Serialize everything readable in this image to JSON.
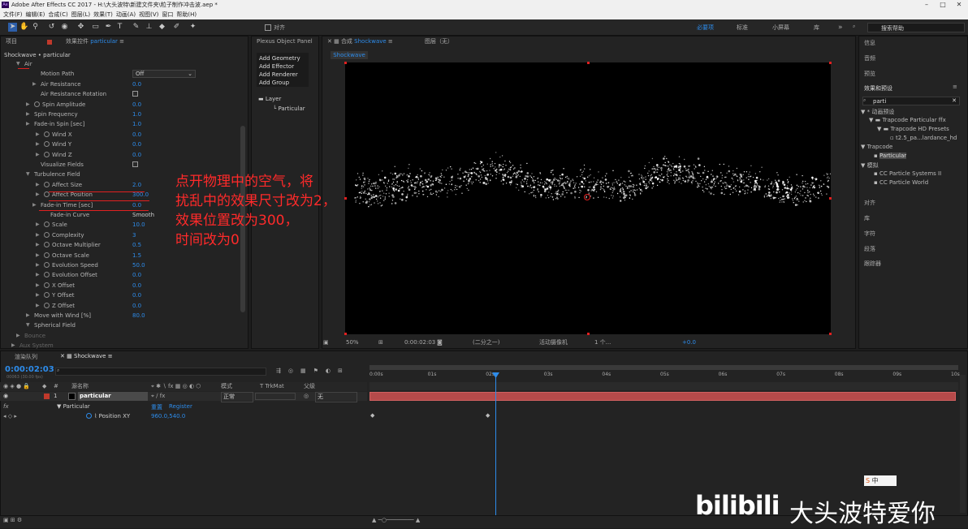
{
  "window": {
    "title": "Adobe After Effects CC 2017 - H:\\大头波特\\新建文件夹\\粒子制作冲击波.aep *",
    "app_icon": "Ae"
  },
  "menu": [
    "文件(F)",
    "编辑(E)",
    "合成(C)",
    "图层(L)",
    "效果(T)",
    "动画(A)",
    "视图(V)",
    "窗口",
    "帮助(H)"
  ],
  "toolbar": {
    "align_label": "对齐",
    "workspaces": [
      "必要项",
      "标准",
      "小屏幕",
      "库"
    ],
    "search_placeholder": "搜索帮助"
  },
  "effects_panel": {
    "project_tab": "项目",
    "tab_prefix": "效果控件",
    "tab_target": "particular",
    "breadcrumb": "Shockwave • particular",
    "properties": [
      {
        "label": "Air",
        "kind": "group"
      },
      {
        "label": "Motion Path",
        "kind": "dropdown",
        "value": "Off"
      },
      {
        "label": "Air Resistance",
        "kind": "value",
        "value": "0.0"
      },
      {
        "label": "Air Resistance Rotation",
        "kind": "check"
      },
      {
        "label": "Spin Amplitude",
        "kind": "value",
        "value": "0.0",
        "sw": true
      },
      {
        "label": "Spin Frequency",
        "kind": "value",
        "value": "1.0"
      },
      {
        "label": "Fade-in Spin [sec]",
        "kind": "value",
        "value": "1.0"
      },
      {
        "label": "Wind X",
        "kind": "value",
        "value": "0.0",
        "sw": true
      },
      {
        "label": "Wind Y",
        "kind": "value",
        "value": "0.0",
        "sw": true
      },
      {
        "label": "Wind Z",
        "kind": "value",
        "value": "0.0",
        "sw": true
      },
      {
        "label": "Visualize Fields",
        "kind": "check"
      },
      {
        "label": "Turbulence Field",
        "kind": "group"
      },
      {
        "label": "Affect Size",
        "kind": "value",
        "value": "2.0",
        "sw": true
      },
      {
        "label": "Affect Position",
        "kind": "value",
        "value": "300.0",
        "sw": true
      },
      {
        "label": "Fade-in Time [sec]",
        "kind": "value",
        "value": "0.0"
      },
      {
        "label": "Fade-in Curve",
        "kind": "text",
        "value": "Smooth"
      },
      {
        "label": "Scale",
        "kind": "value",
        "value": "10.0",
        "sw": true
      },
      {
        "label": "Complexity",
        "kind": "value",
        "value": "3",
        "sw": true
      },
      {
        "label": "Octave Multiplier",
        "kind": "value",
        "value": "0.5",
        "sw": true
      },
      {
        "label": "Octave Scale",
        "kind": "value",
        "value": "1.5",
        "sw": true
      },
      {
        "label": "Evolution Speed",
        "kind": "value",
        "value": "50.0",
        "sw": true
      },
      {
        "label": "Evolution Offset",
        "kind": "value",
        "value": "0.0",
        "sw": true
      },
      {
        "label": "X Offset",
        "kind": "value",
        "value": "0.0",
        "sw": true
      },
      {
        "label": "Y Offset",
        "kind": "value",
        "value": "0.0",
        "sw": true
      },
      {
        "label": "Z Offset",
        "kind": "value",
        "value": "0.0",
        "sw": true
      },
      {
        "label": "Move with Wind [%]",
        "kind": "value",
        "value": "80.0"
      },
      {
        "label": "Spherical Field",
        "kind": "group"
      },
      {
        "label": "Bounce",
        "kind": "group"
      },
      {
        "label": "Aux System",
        "kind": "group"
      }
    ]
  },
  "plexus": {
    "title": "Plexus Object Panel",
    "buttons": [
      "Add Geometry",
      "Add Effector",
      "Add Renderer",
      "Add Group"
    ],
    "tree_root": "Layer",
    "tree_child": "Particular"
  },
  "composition": {
    "tab_prefix": "合成",
    "tab_name": "Shockwave",
    "layer_tab": "图层（无）",
    "subtab": "Shockwave"
  },
  "viewer_bar": {
    "zoom": "50%",
    "timecode": "0:00:02:03",
    "resolution": "(二分之一)",
    "camera": "活动摄像机",
    "views": "1 个...",
    "exposure": "+0.0"
  },
  "annotation": [
    "点开物理中的空气，将",
    "扰乱中的效果尺寸改为2，",
    "效果位置改为300，",
    "时间改为0"
  ],
  "right_panel": {
    "top": [
      "信息",
      "音频",
      "预览"
    ],
    "effects_title": "效果和预设",
    "search": "parti",
    "tree": [
      "* 动画预设",
      "Trapcode Particular ffx",
      "Trapcode HD Presets",
      "t2.5_pa...lardance_hd",
      "Trapcode",
      "Particular",
      "模拟",
      "CC Particle Systems II",
      "CC Particle World"
    ],
    "bottom": [
      "对齐",
      "库",
      "字符",
      "段落",
      "跟踪器"
    ]
  },
  "timeline": {
    "render_tab": "渲染队列",
    "comp_tab": "Shockwave",
    "timecode": "0:00:02:03",
    "frames": "00063 (30.00 fps)",
    "col_source": "源名称",
    "col_mode": "模式",
    "col_trk": "T  TrkMat",
    "col_parent": "父级",
    "layer_num": "1",
    "layer_name": "particular",
    "layer_mode": "正常",
    "parent": "无",
    "effect": "Particular",
    "reset": "重置",
    "register": "Register",
    "prop": "Position XY",
    "prop_val": "960.0,540.0",
    "ticks": [
      "0:00s",
      "01s",
      "02s",
      "03s",
      "04s",
      "05s",
      "06s",
      "07s",
      "08s",
      "09s",
      "10s"
    ]
  },
  "watermark": {
    "logo": "bilibili",
    "author": "大头波特爱你"
  },
  "ime": "中"
}
